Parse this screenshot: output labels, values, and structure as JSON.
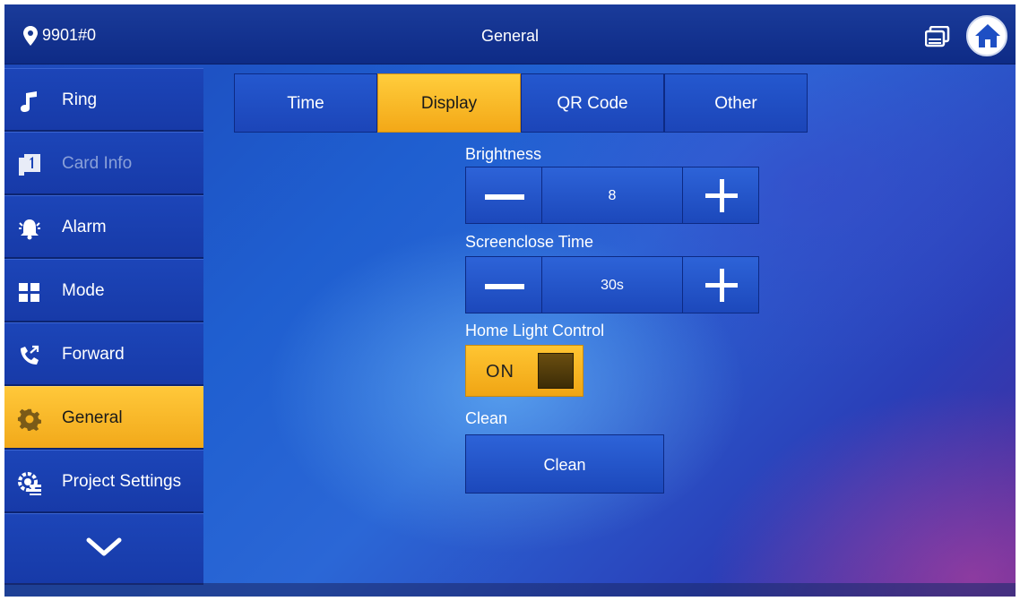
{
  "header": {
    "location": "9901#0",
    "title": "General"
  },
  "sidebar": {
    "items": [
      {
        "label": "Ring",
        "icon": "music-note-icon"
      },
      {
        "label": "Card Info",
        "icon": "card-icon",
        "disabled": true
      },
      {
        "label": "Alarm",
        "icon": "alarm-bell-icon"
      },
      {
        "label": "Mode",
        "icon": "mode-grid-icon"
      },
      {
        "label": "Forward",
        "icon": "forward-call-icon"
      },
      {
        "label": "General",
        "icon": "gear-icon",
        "active": true
      },
      {
        "label": "Project Settings",
        "icon": "project-settings-icon"
      }
    ],
    "more_icon": "chevron-down-icon"
  },
  "tabs": [
    {
      "label": "Time"
    },
    {
      "label": "Display",
      "active": true
    },
    {
      "label": "QR Code"
    },
    {
      "label": "Other"
    }
  ],
  "settings": {
    "brightness": {
      "label": "Brightness",
      "value": "8"
    },
    "screenclose": {
      "label": "Screenclose Time",
      "value": "30s"
    },
    "home_light": {
      "label": "Home Light Control",
      "state": "ON"
    },
    "clean": {
      "label": "Clean",
      "button": "Clean"
    }
  },
  "colors": {
    "accent": "#f5b120",
    "panel": "#1c45b8",
    "background": "#2358cc"
  }
}
